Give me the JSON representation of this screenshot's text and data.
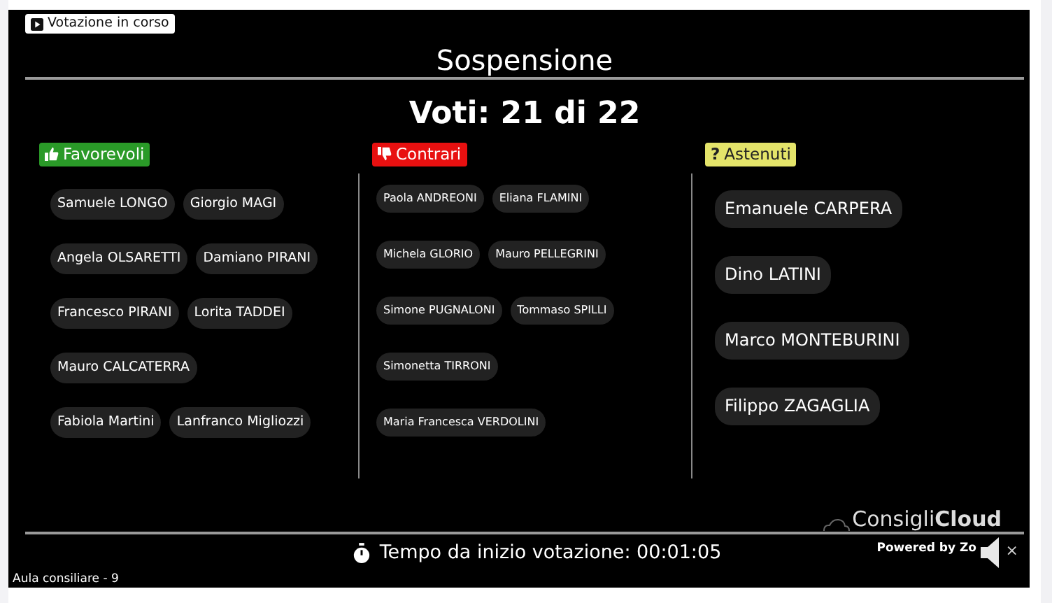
{
  "status_badge": "Votazione in corso",
  "title": "Sospensione",
  "votes": "Voti: 21 di 22",
  "groups": [
    {
      "kind": "favor",
      "label": "Favorevoli",
      "rows": [
        [
          "Samuele LONGO",
          "Giorgio MAGI"
        ],
        [
          "Angela OLSARETTI",
          "Damiano PIRANI"
        ],
        [
          "Francesco PIRANI",
          "Lorita TADDEI"
        ],
        [
          "Mauro CALCATERRA"
        ],
        [
          "Fabiola Martini",
          "Lanfranco Migliozzi"
        ]
      ]
    },
    {
      "kind": "against",
      "label": "Contrari",
      "rows": [
        [
          "Paola ANDREONI",
          "Eliana FLAMINI"
        ],
        [
          "Michela GLORIO",
          "Mauro PELLEGRINI"
        ],
        [
          "Simone PUGNALONI",
          "Tommaso SPILLI"
        ],
        [
          "Simonetta TIRRONI"
        ],
        [
          "Maria Francesca VERDOLINI"
        ]
      ]
    },
    {
      "kind": "abstain",
      "icon": "?",
      "label": "Astenuti",
      "rows": [
        [
          "Emanuele CARPERA"
        ],
        [
          "Dino LATINI"
        ],
        [
          "Marco MONTEBURINI"
        ],
        [
          "Filippo ZAGAGLIA"
        ]
      ]
    }
  ],
  "logo": "Consigli**Cloud**",
  "timer": "Tempo da inizio votazione: 00:01:05",
  "powered": "Powered by Zo",
  "close": "×",
  "room": "Aula consiliare - 9"
}
